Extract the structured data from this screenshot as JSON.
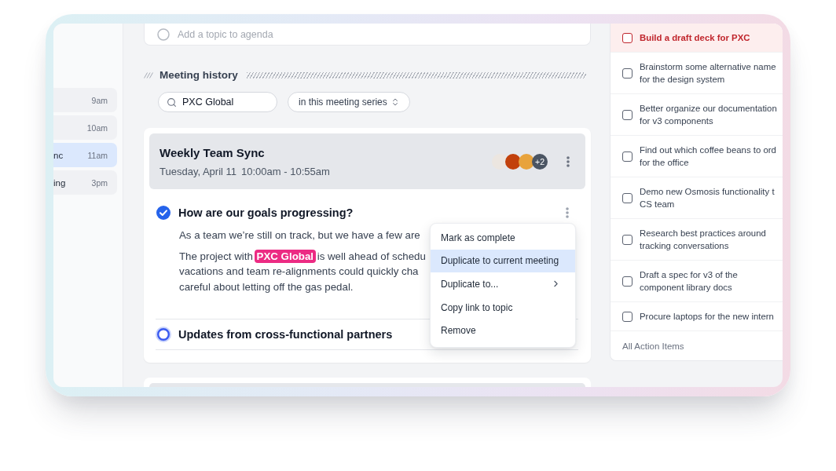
{
  "sidebar": {
    "meetings": [
      {
        "time": "9am",
        "selected": false
      },
      {
        "time": "10am",
        "selected": false
      },
      {
        "title": "nc",
        "time": "11am",
        "selected": true
      },
      {
        "title": "ing",
        "time": "3pm",
        "selected": false
      }
    ]
  },
  "agenda": {
    "placeholder": "Add a topic to agenda"
  },
  "history": {
    "title": "Meeting history",
    "search": {
      "value": "PXC Global"
    },
    "filter": {
      "value": "in this meeting series"
    },
    "meeting": {
      "title": "Weekly Team Sync",
      "date": "Tuesday, April 11",
      "time": "10:00am - 10:55am",
      "avatars": [
        {
          "color": "#ece6e0"
        },
        {
          "color": "#c2410c"
        },
        {
          "color": "#e8a33c"
        }
      ],
      "more": "+2",
      "topics": [
        {
          "title": "How are our goals progressing?",
          "completed": true,
          "focused": false,
          "paragraphs": [
            {
              "lines": [
                {
                  "segments": [
                    {
                      "kind": "text",
                      "text": "As a team we’re still on track, but we have a few are"
                    }
                  ]
                }
              ]
            },
            {
              "lines": [
                {
                  "segments": [
                    {
                      "kind": "text",
                      "text": "The project with"
                    },
                    {
                      "kind": "mention",
                      "text": "PXC Global"
                    },
                    {
                      "kind": "text",
                      "text": "is well ahead of schedu"
                    }
                  ]
                },
                {
                  "segments": [
                    {
                      "kind": "text",
                      "text": "vacations and team re-alignments could quickly cha"
                    }
                  ]
                },
                {
                  "segments": [
                    {
                      "kind": "text",
                      "text": "careful about letting off the gas pedal."
                    }
                  ]
                }
              ]
            }
          ]
        },
        {
          "title": "Updates from cross-functional partners",
          "completed": false,
          "focused": true
        }
      ],
      "menu": {
        "items": [
          {
            "label": "Mark as complete",
            "selected": false,
            "submenu": false
          },
          {
            "label": "Duplicate to current meeting",
            "selected": true,
            "submenu": false
          },
          {
            "label": "Duplicate to...",
            "selected": false,
            "submenu": true
          },
          {
            "label": "Copy link to topic",
            "selected": false,
            "submenu": false
          },
          {
            "label": "Remove",
            "selected": false,
            "submenu": false
          }
        ]
      }
    }
  },
  "action_items": {
    "items": [
      {
        "text": "Build a draft deck for PXC",
        "checked": false,
        "overdue": true
      },
      {
        "text": "Brainstorm some alternative name\nfor the design system",
        "checked": false,
        "overdue": false
      },
      {
        "text": "Better organize our documentation\nfor v3 components",
        "checked": false,
        "overdue": false
      },
      {
        "text": "Find out which coffee beans to ord\nfor the office",
        "checked": false,
        "overdue": false
      },
      {
        "text": "Demo new Osmosis functionality t\nCS team",
        "checked": false,
        "overdue": false
      },
      {
        "text": "Research best practices around\ntracking conversations",
        "checked": false,
        "overdue": false
      },
      {
        "text": "Draft a spec for v3 of the\ncomponent library docs",
        "checked": false,
        "overdue": false
      },
      {
        "text": "Procure laptops for the new intern",
        "checked": false,
        "overdue": false
      }
    ],
    "footer": "All Action Items"
  }
}
